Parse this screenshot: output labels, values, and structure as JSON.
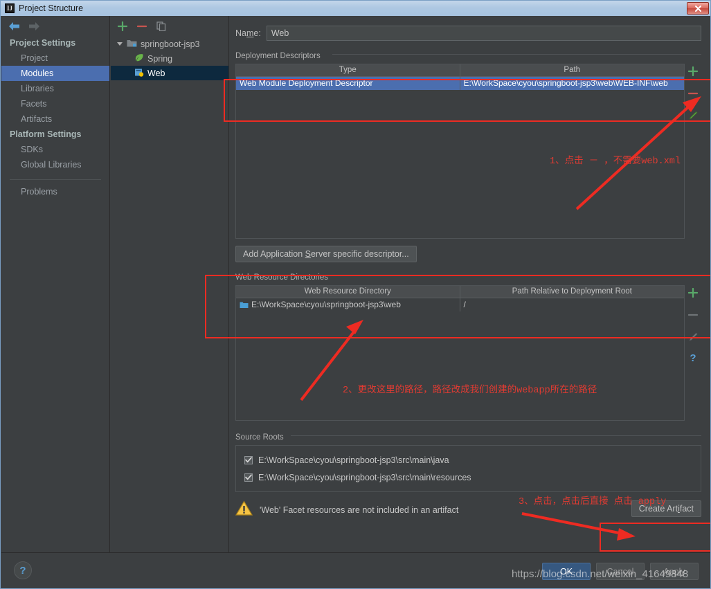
{
  "window": {
    "title": "Project Structure",
    "app_icon": "intellij-idea-icon",
    "close_label": "✕"
  },
  "sidebar": {
    "nav": {
      "back_icon": "arrow-left-icon",
      "forward_icon": "arrow-right-icon"
    },
    "groups": [
      {
        "label": "Project Settings",
        "items": [
          {
            "label": "Project",
            "selected": false
          },
          {
            "label": "Modules",
            "selected": true
          },
          {
            "label": "Libraries",
            "selected": false
          },
          {
            "label": "Facets",
            "selected": false
          },
          {
            "label": "Artifacts",
            "selected": false
          }
        ]
      },
      {
        "label": "Platform Settings",
        "items": [
          {
            "label": "SDKs",
            "selected": false
          },
          {
            "label": "Global Libraries",
            "selected": false
          }
        ]
      }
    ],
    "problems_label": "Problems"
  },
  "tree": {
    "toolbar": {
      "add_icon": "plus-icon",
      "remove_icon": "minus-icon",
      "copy_icon": "copy-icon"
    },
    "nodes": [
      {
        "label": "springboot-jsp3",
        "icon": "module-folder-icon",
        "level": 0,
        "expanded": true,
        "selected": false
      },
      {
        "label": "Spring",
        "icon": "spring-leaf-icon",
        "level": 1,
        "selected": false
      },
      {
        "label": "Web",
        "icon": "web-facet-icon",
        "level": 1,
        "selected": true
      }
    ]
  },
  "main": {
    "name": {
      "label": "Na",
      "label_underline": "m",
      "label_rest": "e:",
      "value": "Web",
      "placeholder": ""
    },
    "deployment_descriptors": {
      "title": "Deployment Descriptors",
      "columns": [
        "Type",
        "Path"
      ],
      "rows": [
        {
          "type": "Web Module Deployment Descriptor",
          "path": "E:\\WorkSpace\\cyou\\springboot-jsp3\\web\\WEB-INF\\web",
          "selected": true
        }
      ],
      "tools": [
        "plus-icon",
        "minus-icon",
        "pencil-icon"
      ]
    },
    "add_app_server_button": {
      "prefix": "Add Application ",
      "underline": "S",
      "suffix": "erver specific descriptor..."
    },
    "web_resource_directories": {
      "title": "Web Resource Directories",
      "columns": [
        "Web Resource Directory",
        "Path Relative to Deployment Root"
      ],
      "rows": [
        {
          "directory": "E:\\WorkSpace\\cyou\\springboot-jsp3\\web",
          "relative_path": "/",
          "icon": "folder-icon"
        }
      ],
      "tools": [
        "plus-icon",
        "minus-icon",
        "pencil-icon",
        "help-icon"
      ]
    },
    "source_roots": {
      "title": "Source Roots",
      "rows": [
        {
          "path": "E:\\WorkSpace\\cyou\\springboot-jsp3\\src\\main\\java",
          "checked": true
        },
        {
          "path": "E:\\WorkSpace\\cyou\\springboot-jsp3\\src\\main\\resources",
          "checked": true
        }
      ]
    },
    "warning": {
      "icon": "warning-triangle-icon",
      "text": "'Web' Facet resources are not included in an artifact",
      "button": {
        "prefix": "Create Art",
        "underline": "i",
        "suffix": "fact"
      }
    }
  },
  "bottom": {
    "help_icon": "question-mark-icon",
    "buttons": [
      {
        "label": "OK",
        "style": "primary"
      },
      {
        "label": "Cancel",
        "style": "normal"
      },
      {
        "label": "Apply",
        "style": "normal"
      }
    ]
  },
  "annotations": {
    "color": "#e13b32",
    "note1": "1、点击 － ，不需要web.xml",
    "note2": "2、更改这里的路径，路径改成我们创建的webapp所在的路径",
    "note3": "3、点击，点击后直接 点击 apply"
  },
  "watermark": "https://blog.csdn.net/weixin_41649848"
}
